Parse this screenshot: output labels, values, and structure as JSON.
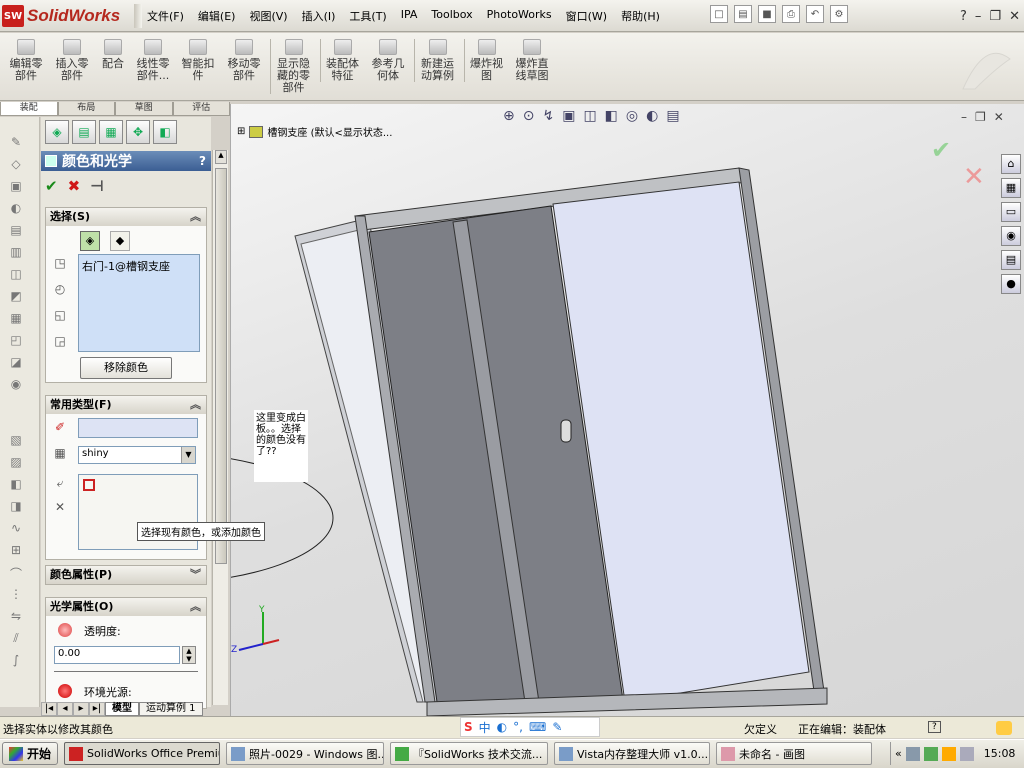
{
  "app": {
    "logo_ds": "SW",
    "logo_name": "SolidWorks"
  },
  "menu": [
    "文件(F)",
    "编辑(E)",
    "视图(V)",
    "插入(I)",
    "工具(T)",
    "IPA",
    "Toolbox",
    "PhotoWorks",
    "窗口(W)",
    "帮助(H)"
  ],
  "commands": [
    {
      "label": "编辑零\n部件"
    },
    {
      "label": "插入零\n部件"
    },
    {
      "label": "配合"
    },
    {
      "label": "线性零\n部件..."
    },
    {
      "label": "智能扣\n件"
    },
    {
      "label": "移动零\n部件"
    },
    {
      "label": "显示隐\n藏的零\n部件"
    },
    {
      "label": "装配体\n特征"
    },
    {
      "label": "参考几\n何体"
    },
    {
      "label": "新建运\n动算例"
    },
    {
      "label": "爆炸视\n图"
    },
    {
      "label": "爆炸直\n线草图"
    }
  ],
  "cm_tabs": [
    "装配",
    "布局",
    "草图",
    "评估"
  ],
  "panel": {
    "title": "颜色和光学",
    "help": "?",
    "sel_title": "选择(S)",
    "sel_item": "右门-1@槽钢支座",
    "remove_color": "移除颜色",
    "common_title": "常用类型(F)",
    "shiny_value": "shiny",
    "color_title": "颜色属性(P)",
    "optical_title": "光学属性(O)",
    "transparency_label": "透明度:",
    "transparency_value": "0.00",
    "ambient_label": "环境光源:"
  },
  "bottom_tabs": [
    "模型",
    "运动算例 1"
  ],
  "viewport": {
    "tree_text": "槽钢支座 (默认<显示状态..."
  },
  "annotations": {
    "note": "这里变成白板。。选择的颜色没有了??",
    "hint": "选择现有颜色，或添加颜色"
  },
  "status": {
    "left": "选择实体以修改其颜色",
    "units": "欠定义",
    "editing": "正在编辑：装配体",
    "help_icon": "?"
  },
  "taskbar": {
    "start": "开始",
    "tasks": [
      "SolidWorks Office Premiu...",
      "照片-0029 - Windows 图...",
      "『SolidWorks 技术交流...",
      "Vista内存整理大师 v1.0...",
      "未命名 - 画图"
    ],
    "clock": "15:08"
  }
}
